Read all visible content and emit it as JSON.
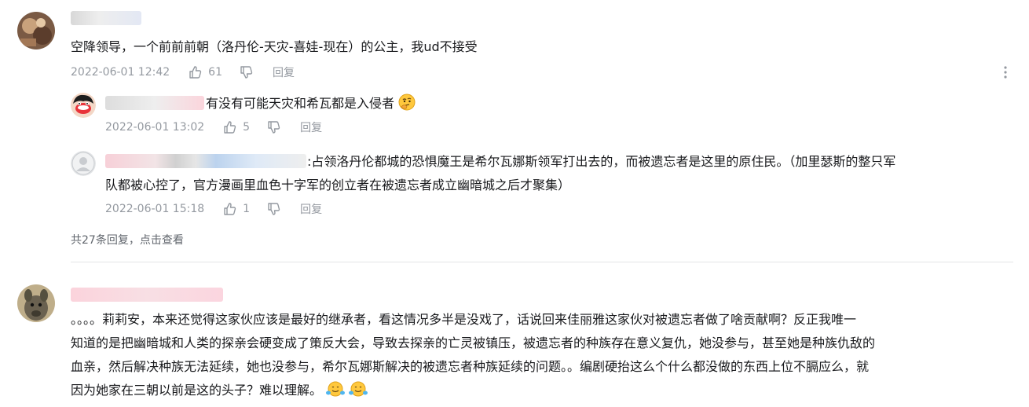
{
  "comments": [
    {
      "text": "空降领导，一个前前前朝（洛丹伦-天灾-喜娃-现在）的公主，我ud不接受",
      "date": "2022-06-01 12:42",
      "likes": "61",
      "reply_label": "回复",
      "replies": [
        {
          "text": " 有没有可能天灾和希瓦都是入侵者",
          "emoji": "thinking-face",
          "date": "2022-06-01 13:02",
          "likes": "5",
          "reply_label": "回复"
        },
        {
          "text": ":占领洛丹伦都城的恐惧魔王是希尔瓦娜斯领军打出去的，而被遗忘者是这里的原住民。（加里瑟斯的整只军",
          "text2": "队都被心控了，官方漫画里血色十字军的创立者在被遗忘者成立幽暗城之后才聚集）",
          "date": "2022-06-01 15:18",
          "likes": "1",
          "reply_label": "回复"
        }
      ],
      "summary_count": "共27条回复，",
      "summary_link": "点击查看"
    },
    {
      "lines": [
        "。。。。莉莉安，本来还觉得这家伙应该是最好的继承者，看这情况多半是没戏了，话说回来佳丽雅这家伙对被遗忘者做了啥贡献啊？反正我唯一",
        "知道的是把幽暗城和人类的探亲会硬变成了策反大会，导致去探亲的亡灵被镇压，被遗忘者的种族存在意义复仇，她没参与，甚至她是种族仇敌的",
        "血亲，然后解决种族无法延续，她也没参与，希尔瓦娜斯解决的被遗忘者种族延续的问题。。编剧硬抬这么个什么都没做的东西上位不膈应么，就",
        "因为她家在三朝以前是这的头子？难以理解。"
      ],
      "emoji": "shrug-emoji"
    }
  ],
  "colors": {
    "text": "#18191c",
    "meta": "#9499a0",
    "divider": "#e3e5e7"
  }
}
